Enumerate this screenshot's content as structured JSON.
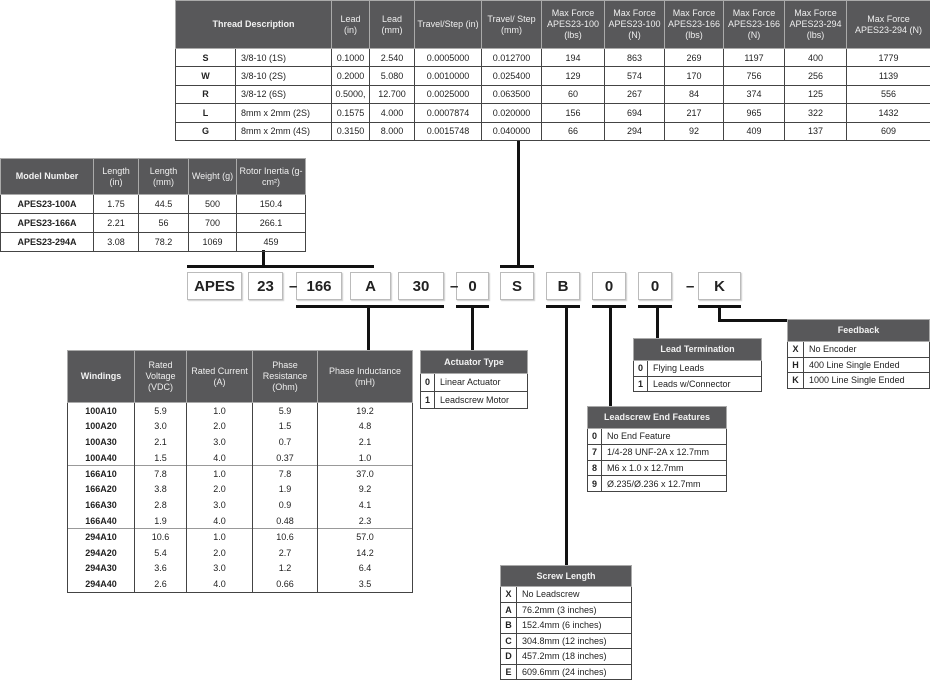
{
  "thread_table": {
    "headers": [
      "Thread Description",
      "Lead (in)",
      "Lead (mm)",
      "Travel/Step (in)",
      "Travel/ Step (mm)",
      "Max Force APES23-100 (lbs)",
      "Max Force APES23-100 (N)",
      "Max Force APES23-166 (lbs)",
      "Max Force APES23-166 (N)",
      "Max Force APES23-294 (lbs)",
      "Max Force APES23-294 (N)"
    ],
    "rows": [
      [
        "S",
        "3/8-10 (1S)",
        "0.1000",
        "2.540",
        "0.0005000",
        "0.012700",
        "194",
        "863",
        "269",
        "1197",
        "400",
        "1779"
      ],
      [
        "W",
        "3/8-10 (2S)",
        "0.2000",
        "5.080",
        "0.0010000",
        "0.025400",
        "129",
        "574",
        "170",
        "756",
        "256",
        "1139"
      ],
      [
        "R",
        "3/8-12 (6S)",
        "0.5000,",
        "12.700",
        "0.0025000",
        "0.063500",
        "60",
        "267",
        "84",
        "374",
        "125",
        "556"
      ],
      [
        "L",
        "8mm x 2mm (2S)",
        "0.1575",
        "4.000",
        "0.0007874",
        "0.020000",
        "156",
        "694",
        "217",
        "965",
        "322",
        "1432"
      ],
      [
        "G",
        "8mm x 2mm (4S)",
        "0.3150",
        "8.000",
        "0.0015748",
        "0.040000",
        "66",
        "294",
        "92",
        "409",
        "137",
        "609"
      ]
    ]
  },
  "model_table": {
    "headers": [
      "Model Number",
      "Length (in)",
      "Length (mm)",
      "Weight (g)",
      "Rotor Inertia (g-cm²)"
    ],
    "rows": [
      [
        "APES23-100A",
        "1.75",
        "44.5",
        "500",
        "150.4"
      ],
      [
        "APES23-166A",
        "2.21",
        "56",
        "700",
        "266.1"
      ],
      [
        "APES23-294A",
        "3.08",
        "78.2",
        "1069",
        "459"
      ]
    ]
  },
  "part_number": {
    "segments": [
      "APES",
      "23",
      "166",
      "A",
      "30",
      "0",
      "S",
      "B",
      "0",
      "0",
      "K"
    ],
    "separator": "–"
  },
  "windings_table": {
    "headers": [
      "Windings",
      "Rated Voltage (VDC)",
      "Rated Current (A)",
      "Phase Resistance (Ohm)",
      "Phase Inductance (mH)"
    ],
    "rows": [
      [
        "100A10",
        "5.9",
        "1.0",
        "5.9",
        "19.2"
      ],
      [
        "100A20",
        "3.0",
        "2.0",
        "1.5",
        "4.8"
      ],
      [
        "100A30",
        "2.1",
        "3.0",
        "0.7",
        "2.1"
      ],
      [
        "100A40",
        "1.5",
        "4.0",
        "0.37",
        "1.0"
      ],
      [
        "166A10",
        "7.8",
        "1.0",
        "7.8",
        "37.0"
      ],
      [
        "166A20",
        "3.8",
        "2.0",
        "1.9",
        "9.2"
      ],
      [
        "166A30",
        "2.8",
        "3.0",
        "0.9",
        "4.1"
      ],
      [
        "166A40",
        "1.9",
        "4.0",
        "0.48",
        "2.3"
      ],
      [
        "294A10",
        "10.6",
        "1.0",
        "10.6",
        "57.0"
      ],
      [
        "294A20",
        "5.4",
        "2.0",
        "2.7",
        "14.2"
      ],
      [
        "294A30",
        "3.6",
        "3.0",
        "1.2",
        "6.4"
      ],
      [
        "294A40",
        "2.6",
        "4.0",
        "0.66",
        "3.5"
      ]
    ]
  },
  "actuator_type": {
    "title": "Actuator Type",
    "rows": [
      [
        "0",
        "Linear Actuator"
      ],
      [
        "1",
        "Leadscrew Motor"
      ]
    ]
  },
  "lead_termination": {
    "title": "Lead Termination",
    "rows": [
      [
        "0",
        "Flying Leads"
      ],
      [
        "1",
        "Leads w/Connector"
      ]
    ]
  },
  "feedback": {
    "title": "Feedback",
    "rows": [
      [
        "X",
        "No Encoder"
      ],
      [
        "H",
        "400 Line Single Ended"
      ],
      [
        "K",
        "1000 Line Single Ended"
      ]
    ]
  },
  "leadscrew_end": {
    "title": "Leadscrew End Features",
    "rows": [
      [
        "0",
        "No End Feature"
      ],
      [
        "7",
        "1/4-28 UNF-2A x 12.7mm"
      ],
      [
        "8",
        "M6 x 1.0 x 12.7mm"
      ],
      [
        "9",
        "Ø.235/Ø.236 x 12.7mm"
      ]
    ]
  },
  "screw_length": {
    "title": "Screw Length",
    "rows": [
      [
        "X",
        "No Leadscrew"
      ],
      [
        "A",
        "76.2mm (3 inches)"
      ],
      [
        "B",
        "152.4mm (6 inches)"
      ],
      [
        "C",
        "304.8mm (12 inches)"
      ],
      [
        "D",
        "457.2mm (18 inches)"
      ],
      [
        "E",
        "609.6mm (24 inches)"
      ]
    ]
  }
}
